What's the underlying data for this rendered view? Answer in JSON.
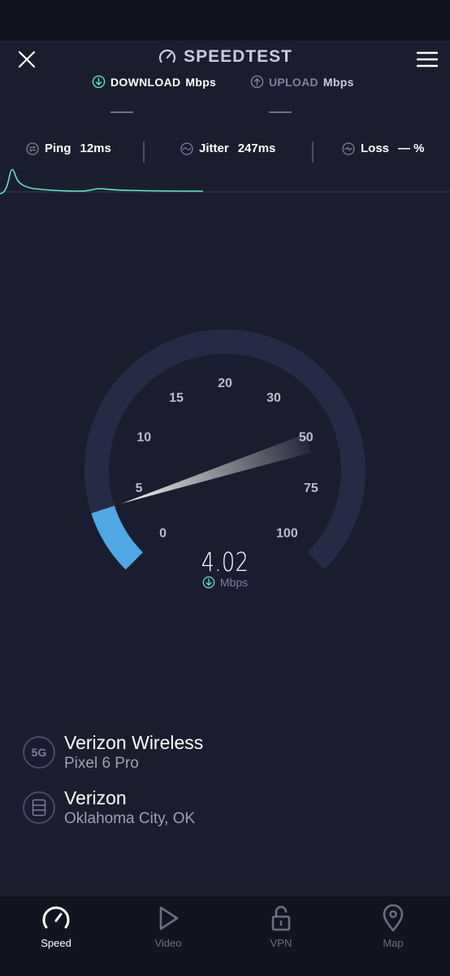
{
  "app": {
    "title": "SPEEDTEST"
  },
  "metrics": {
    "download": {
      "label": "DOWNLOAD",
      "unit": "Mbps",
      "value": "—"
    },
    "upload": {
      "label": "UPLOAD",
      "unit": "Mbps",
      "value": "—"
    }
  },
  "stats": {
    "ping": {
      "label": "Ping",
      "value": "12ms"
    },
    "jitter": {
      "label": "Jitter",
      "value": "247ms"
    },
    "loss": {
      "label": "Loss",
      "value": "— %"
    }
  },
  "gauge": {
    "value": "4.02",
    "unit": "Mbps",
    "ticks": [
      "0",
      "5",
      "10",
      "15",
      "20",
      "30",
      "50",
      "75",
      "100"
    ],
    "needle_mbps": 4.02,
    "accent_color": "#4ea8e6",
    "track_color": "#252b45"
  },
  "providers": [
    {
      "badge": "5G",
      "name": "Verizon Wireless",
      "sub": "Pixel 6 Pro"
    },
    {
      "badge": "",
      "name": "Verizon",
      "sub": "Oklahoma City, OK"
    }
  ],
  "nav": [
    {
      "label": "Speed",
      "active": true
    },
    {
      "label": "Video",
      "active": false
    },
    {
      "label": "VPN",
      "active": false
    },
    {
      "label": "Map",
      "active": false
    }
  ],
  "colors": {
    "background": "#1a1d2e",
    "download_accent": "#5ee0d0",
    "graph_line": "#5ee0d0"
  }
}
